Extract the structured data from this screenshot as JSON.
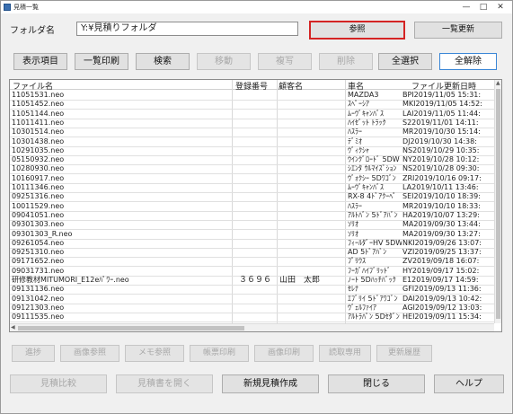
{
  "window": {
    "title": "見積一覧",
    "min": "—",
    "max": "□",
    "close": "✕"
  },
  "folder": {
    "label": "フォルダ名",
    "value": "Y:¥見積りフォルダ"
  },
  "top_buttons": {
    "browse": "参照",
    "refresh": "一覧更新"
  },
  "toolbar": {
    "items": [
      {
        "label": "表示項目",
        "enabled": true
      },
      {
        "label": "一覧印刷",
        "enabled": true
      },
      {
        "label": "検索",
        "enabled": true
      },
      {
        "label": "移動",
        "enabled": false
      },
      {
        "label": "複写",
        "enabled": false
      },
      {
        "label": "削除",
        "enabled": false
      },
      {
        "label": "全選択",
        "enabled": true
      },
      {
        "label": "全解除",
        "enabled": true
      }
    ]
  },
  "table": {
    "headers": {
      "file": "ファイル名",
      "number": "登録番号",
      "customer": "顧客名",
      "car": "車名",
      "updated": "ファイル更新日時"
    },
    "rows": [
      {
        "file": "11051531.neo",
        "number": "",
        "customer": "",
        "car": "MAZDA3",
        "updated": "BPI2019/11/05 15:31:"
      },
      {
        "file": "11051452.neo",
        "number": "",
        "customer": "",
        "car": "ｽﾍﾟｰｼｱ",
        "updated": "MKI2019/11/05 14:52:"
      },
      {
        "file": "11051144.neo",
        "number": "",
        "customer": "",
        "car": "ﾑｰｳﾞｷｬﾝﾊﾞｽ",
        "updated": "LAI2019/11/05 11:44:"
      },
      {
        "file": "11011411.neo",
        "number": "",
        "customer": "",
        "car": "ﾊｲｾﾞｯﾄ ﾄﾗｯｸ",
        "updated": "S22019/11/01 14:11:"
      },
      {
        "file": "10301514.neo",
        "number": "",
        "customer": "",
        "car": "ﾊｽﾗｰ",
        "updated": "MR2019/10/30 15:14:"
      },
      {
        "file": "10301438.neo",
        "number": "",
        "customer": "",
        "car": "ﾃﾞﾐｵ",
        "updated": "DJ2019/10/30 14:38:"
      },
      {
        "file": "10291035.neo",
        "number": "",
        "customer": "",
        "car": "ｳﾞｨｸｼｬ",
        "updated": "NS2019/10/29 10:35:"
      },
      {
        "file": "05150932.neo",
        "number": "",
        "customer": "",
        "car": "ｳｲﾝｸﾞﾛｰﾄﾞ 5DW",
        "updated": "NY2019/10/28 10:12:"
      },
      {
        "file": "10280930.neo",
        "number": "",
        "customer": "",
        "car": "ｼｴﾝﾀ ｳﾙﾏｲｽﾞｼｮﾝ",
        "updated": "NS2019/10/28 09:30:"
      },
      {
        "file": "10160917.neo",
        "number": "",
        "customer": "",
        "car": "ｳﾞｫｸｼｰ 5Dﾜｺﾞﾝ",
        "updated": "ZRI2019/10/16 09:17:"
      },
      {
        "file": "10111346.neo",
        "number": "",
        "customer": "",
        "car": "ﾑｰｳﾞｷｬﾝﾊﾞｽ",
        "updated": "LA2019/10/11 13:46:"
      },
      {
        "file": "09251316.neo",
        "number": "",
        "customer": "",
        "car": "RX-8 4ﾄﾞｱｸｰﾍﾟ",
        "updated": "SEI2019/10/10 18:39:"
      },
      {
        "file": "10011529.neo",
        "number": "",
        "customer": "",
        "car": "ﾊｽﾗｰ",
        "updated": "MR2019/10/10 18:33:"
      },
      {
        "file": "09041051.neo",
        "number": "",
        "customer": "",
        "car": "ｱﾙﾄﾊﾞﾝ 5ﾄﾞｱﾊﾞﾝ",
        "updated": "HA2019/10/07 13:29:"
      },
      {
        "file": "09301303.neo",
        "number": "",
        "customer": "",
        "car": "ｿﾘｵ",
        "updated": "MA2019/09/30 13:44:"
      },
      {
        "file": "09301303_R.neo",
        "number": "",
        "customer": "",
        "car": "ｿﾘｵ",
        "updated": "MA2019/09/30 13:27:"
      },
      {
        "file": "09261054.neo",
        "number": "",
        "customer": "",
        "car": "ﾌｨｰﾙﾀﾞｰHV 5DW",
        "updated": "NKI2019/09/26 13:07:"
      },
      {
        "file": "09251310.neo",
        "number": "",
        "customer": "",
        "car": "AD 5ﾄﾞｱﾊﾞﾝ",
        "updated": "VZI2019/09/25 13:37:"
      },
      {
        "file": "09171652.neo",
        "number": "",
        "customer": "",
        "car": "ﾌﾟﾘｳｽ",
        "updated": "ZV2019/09/18 16:07:"
      },
      {
        "file": "09031731.neo",
        "number": "",
        "customer": "",
        "car": "ﾌｰｶﾞﾊｲﾌﾞﾘｯﾄﾞ",
        "updated": "HY2019/09/17 15:02:"
      },
      {
        "file": "研修教材MITUMORI_E12eﾊﾟﾜｰ.neo",
        "number": "３６９６",
        "customer": "山田　太郎",
        "car": "ﾉｰﾄ 5Dﾊｯﾁﾊﾞｯｸ",
        "updated": "E12019/09/17 14:59:"
      },
      {
        "file": "09131136.neo",
        "number": "",
        "customer": "",
        "car": "ｾﾚﾅ",
        "updated": "GFI2019/09/13 11:36:"
      },
      {
        "file": "09131042.neo",
        "number": "",
        "customer": "",
        "car": "ｴﾌﾞﾘｲ 5ﾄﾞｱﾜｺﾞﾝ",
        "updated": "DAI2019/09/13 10:42:"
      },
      {
        "file": "09121303.neo",
        "number": "",
        "customer": "",
        "car": "ｳﾞｪﾙﾌｧｲｱ",
        "updated": "AGI2019/09/12 13:03:"
      },
      {
        "file": "09111535.neo",
        "number": "",
        "customer": "",
        "car": "ｱﾙﾄﾗﾊﾟﾝ 5Dｾﾀﾞﾝ",
        "updated": "HEI2019/09/11 15:34:"
      }
    ]
  },
  "action_row": [
    "進捗",
    "画像参照",
    "メモ参照",
    "帳票印刷",
    "画像印刷",
    "読取専用",
    "更新履歴"
  ],
  "bottom_row": {
    "items": [
      {
        "label": "見積比較",
        "enabled": false
      },
      {
        "label": "見積書を開く",
        "enabled": false
      },
      {
        "label": "新規見積作成",
        "enabled": true
      },
      {
        "label": "閉じる",
        "enabled": true
      },
      {
        "label": "ヘルプ",
        "enabled": true
      }
    ]
  }
}
